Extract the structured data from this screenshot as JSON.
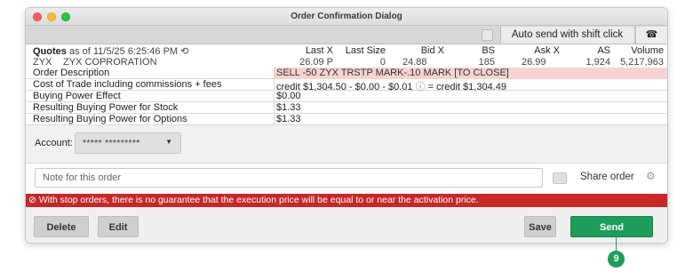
{
  "window": {
    "title": "Order Confirmation Dialog"
  },
  "toolbar": {
    "auto_send_label": "Auto send with shift click",
    "phone_icon": "phone-icon"
  },
  "quotes": {
    "header_label": "Quotes",
    "header_date": "as of 11/5/25 6:25:46 PM",
    "refresh_icon": "refresh-icon",
    "columns": [
      "Last X",
      "Last Size",
      "Bid X",
      "BS",
      "Ask X",
      "AS",
      "Volume"
    ],
    "row": {
      "symbol": "ZYX",
      "name": "ZYX COPRORATION",
      "last_x": "26.09 P",
      "last_size": "0",
      "bid_x": "24.88",
      "bs": "185",
      "ask_x": "26.99",
      "as": "1,924",
      "volume": "5,217,963"
    }
  },
  "info": [
    {
      "label": "Order Description",
      "value": "SELL -50  ZYX  TRSTP MARK-.10 MARK [TO CLOSE]"
    },
    {
      "label": "Cost of Trade including commissions + fees",
      "value_start": "credit $1,304.50 - $0.00 - $0.01",
      "value_end": "= credit $1,304.49",
      "info_icon": "info-icon"
    },
    {
      "label": "Buying Power Effect",
      "value": "$0.00"
    },
    {
      "label": "Resulting Buying Power for Stock",
      "value": "$1.33"
    },
    {
      "label": "Resulting Buying Power for Options",
      "value": "$1.33"
    }
  ],
  "account": {
    "label": "Account:",
    "value": "***** *********"
  },
  "note": {
    "placeholder": "Note for this order"
  },
  "share": {
    "label": "Share order"
  },
  "warning": "With stop orders, there is no guarantee that the execution price will be equal to or near the activation price.",
  "buttons": {
    "delete": "Delete",
    "edit": "Edit",
    "save": "Save",
    "send": "Send"
  },
  "callout": {
    "number": "9"
  },
  "colors": {
    "send_green": "#1e9c5a",
    "warning_red": "#c62828",
    "order_desc_bg": "#f8d2d2"
  }
}
